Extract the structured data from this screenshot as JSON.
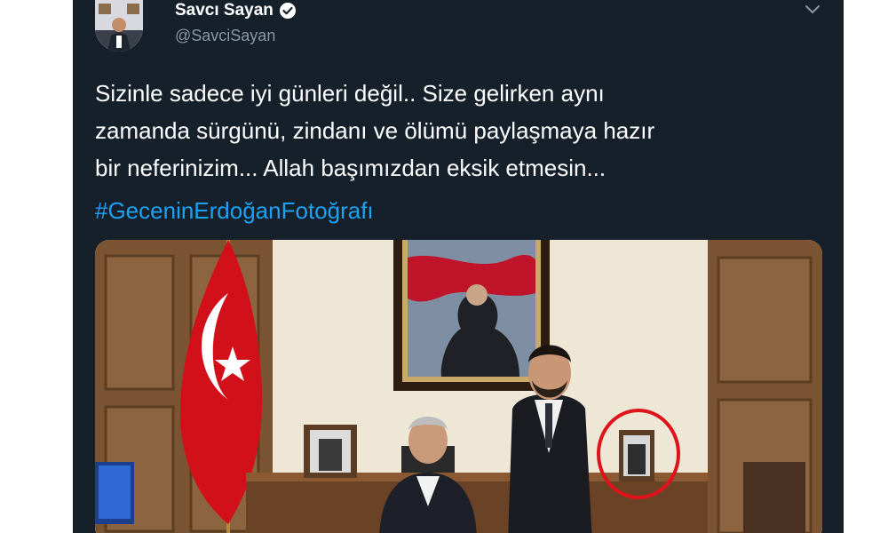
{
  "tweet": {
    "display_name": "Savcı Sayan",
    "handle": "@SavciSayan",
    "text_lines": [
      "Sizinle sadece iyi günleri değil.. Size gelirken aynı",
      "zamanda sürgünü, zindanı ve ölümü paylaşmaya hazır",
      "bir neferinizim... Allah başımızdan eksik etmesin..."
    ],
    "hashtag": "#GeceninErdoğanFotoğrafı"
  },
  "icons": {
    "verified": "verified-badge-icon",
    "menu": "chevron-down-icon"
  },
  "colors": {
    "background": "#15202b",
    "text": "#ffffff",
    "secondary_text": "#8899a6",
    "link": "#1da1f2",
    "highlight_circle": "#e0121b"
  }
}
